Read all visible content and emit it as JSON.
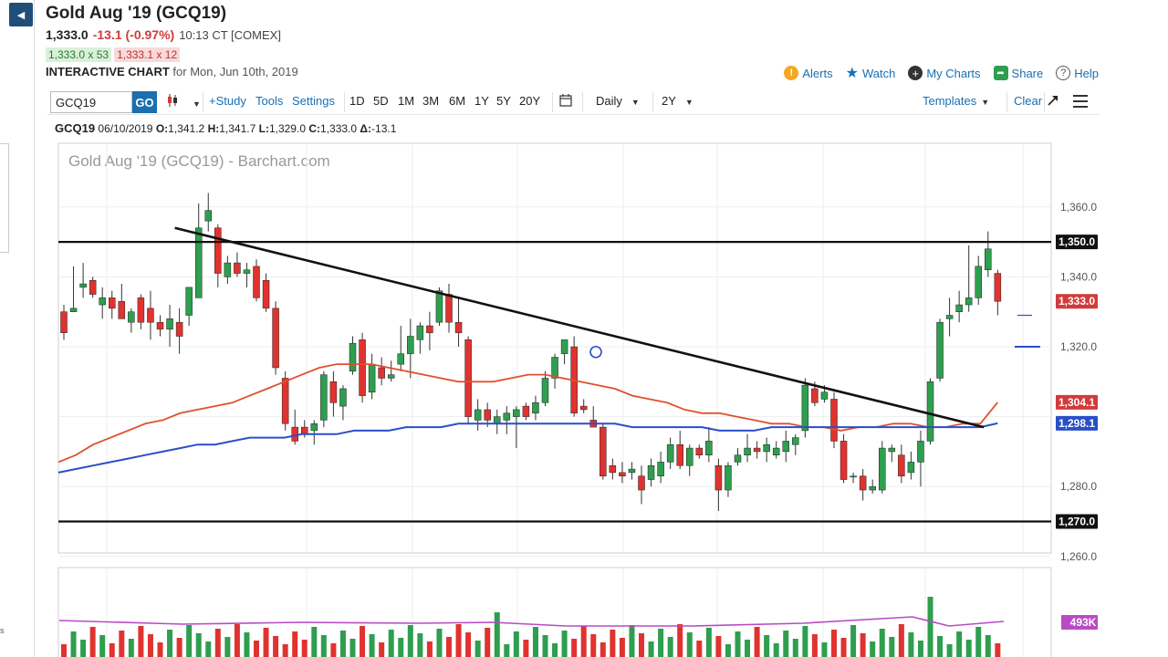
{
  "header": {
    "title": "Gold Aug '19 (GCQ19)",
    "last": "1,333.0",
    "change": "-13.1 (-0.97%)",
    "time": "10:13 CT [COMEX]",
    "bid": "1,333.0 x 53",
    "ask": "1,333.1 x 12",
    "interactive_label": "INTERACTIVE CHART",
    "interactive_date": "for Mon, Jun 10th, 2019"
  },
  "links": {
    "alerts": "Alerts",
    "watch": "Watch",
    "my_charts": "My Charts",
    "share": "Share",
    "help": "Help"
  },
  "toolbar": {
    "symbol": "GCQ19",
    "go": "GO",
    "study": "+Study",
    "tools": "Tools",
    "settings": "Settings",
    "ranges": [
      "1D",
      "5D",
      "1M",
      "3M",
      "6M",
      "1Y",
      "5Y",
      "20Y"
    ],
    "interval": "Daily",
    "period": "2Y",
    "templates": "Templates",
    "clear": "Clear"
  },
  "ohlc": {
    "symbol": "GCQ19",
    "date": "06/10/2019",
    "open_label": "O:",
    "open": "1,341.2",
    "high_label": "H:",
    "high": "1,341.7",
    "low_label": "L:",
    "low": "1,329.0",
    "close_label": "C:",
    "close": "1,333.0",
    "change": "-13.1"
  },
  "chart_data": {
    "type": "candlestick",
    "watermark": "Gold Aug '19 (GCQ19) - Barchart.com",
    "ylim": [
      1255,
      1366
    ],
    "y_ticks": [
      "1,360.0",
      "1,340.0",
      "1,320.0",
      "1,280.0",
      "1,260.0"
    ],
    "y_tick_values": [
      1360,
      1340,
      1320,
      1280,
      1260
    ],
    "price_tags": [
      {
        "label": "1,350.0",
        "value": 1350,
        "color": "#111111"
      },
      {
        "label": "1,333.0",
        "value": 1333,
        "color": "#d23b3b"
      },
      {
        "label": "1,304.1",
        "value": 1304.1,
        "color": "#d23b3b"
      },
      {
        "label": "1,298.1",
        "value": 1298.1,
        "color": "#2a4fc7"
      },
      {
        "label": "1,270.0",
        "value": 1270,
        "color": "#111111"
      }
    ],
    "horizontal_lines": [
      1350,
      1270
    ],
    "trendline": {
      "from": [
        12,
        1354
      ],
      "to": [
        95,
        1297
      ]
    },
    "candles": [
      {
        "o": 1330,
        "h": 1332,
        "l": 1322,
        "c": 1324
      },
      {
        "o": 1330,
        "h": 1343,
        "l": 1330,
        "c": 1331
      },
      {
        "o": 1337,
        "h": 1344,
        "l": 1334,
        "c": 1338
      },
      {
        "o": 1339,
        "h": 1340,
        "l": 1334,
        "c": 1335
      },
      {
        "o": 1332,
        "h": 1337,
        "l": 1328,
        "c": 1334
      },
      {
        "o": 1334,
        "h": 1336,
        "l": 1328,
        "c": 1331
      },
      {
        "o": 1333,
        "h": 1338,
        "l": 1330,
        "c": 1328
      },
      {
        "o": 1327,
        "h": 1331,
        "l": 1324,
        "c": 1330
      },
      {
        "o": 1334,
        "h": 1335,
        "l": 1325,
        "c": 1327
      },
      {
        "o": 1331,
        "h": 1336,
        "l": 1322,
        "c": 1327
      },
      {
        "o": 1327,
        "h": 1329,
        "l": 1323,
        "c": 1325
      },
      {
        "o": 1325,
        "h": 1332,
        "l": 1320,
        "c": 1328
      },
      {
        "o": 1327,
        "h": 1331,
        "l": 1318,
        "c": 1323
      },
      {
        "o": 1329,
        "h": 1337,
        "l": 1326,
        "c": 1337
      },
      {
        "o": 1334,
        "h": 1361,
        "l": 1334,
        "c": 1354
      },
      {
        "o": 1356,
        "h": 1364,
        "l": 1353,
        "c": 1359
      },
      {
        "o": 1354,
        "h": 1355,
        "l": 1337,
        "c": 1341
      },
      {
        "o": 1340,
        "h": 1346,
        "l": 1338,
        "c": 1344
      },
      {
        "o": 1344,
        "h": 1347,
        "l": 1340,
        "c": 1341
      },
      {
        "o": 1341,
        "h": 1344,
        "l": 1337,
        "c": 1342
      },
      {
        "o": 1343,
        "h": 1345,
        "l": 1333,
        "c": 1334
      },
      {
        "o": 1339,
        "h": 1341,
        "l": 1330,
        "c": 1331
      },
      {
        "o": 1331,
        "h": 1333,
        "l": 1312,
        "c": 1314
      },
      {
        "o": 1311,
        "h": 1313,
        "l": 1296,
        "c": 1298
      },
      {
        "o": 1297,
        "h": 1302,
        "l": 1292,
        "c": 1293
      },
      {
        "o": 1297,
        "h": 1299,
        "l": 1294,
        "c": 1295
      },
      {
        "o": 1296,
        "h": 1299,
        "l": 1292,
        "c": 1298
      },
      {
        "o": 1299,
        "h": 1313,
        "l": 1297,
        "c": 1312
      },
      {
        "o": 1310,
        "h": 1313,
        "l": 1300,
        "c": 1304
      },
      {
        "o": 1303,
        "h": 1309,
        "l": 1299,
        "c": 1308
      },
      {
        "o": 1313,
        "h": 1323,
        "l": 1312,
        "c": 1321
      },
      {
        "o": 1322,
        "h": 1324,
        "l": 1304,
        "c": 1306
      },
      {
        "o": 1307,
        "h": 1318,
        "l": 1305,
        "c": 1315
      },
      {
        "o": 1314,
        "h": 1317,
        "l": 1309,
        "c": 1311
      },
      {
        "o": 1311,
        "h": 1316,
        "l": 1310,
        "c": 1312
      },
      {
        "o": 1315,
        "h": 1326,
        "l": 1313,
        "c": 1318
      },
      {
        "o": 1318,
        "h": 1328,
        "l": 1311,
        "c": 1323
      },
      {
        "o": 1322,
        "h": 1327,
        "l": 1318,
        "c": 1326
      },
      {
        "o": 1326,
        "h": 1330,
        "l": 1319,
        "c": 1324
      },
      {
        "o": 1327,
        "h": 1337,
        "l": 1326,
        "c": 1336
      },
      {
        "o": 1335,
        "h": 1338,
        "l": 1324,
        "c": 1327
      },
      {
        "o": 1327,
        "h": 1334,
        "l": 1320,
        "c": 1324
      },
      {
        "o": 1322,
        "h": 1323,
        "l": 1298,
        "c": 1300
      },
      {
        "o": 1299,
        "h": 1305,
        "l": 1296,
        "c": 1302
      },
      {
        "o": 1302,
        "h": 1304,
        "l": 1297,
        "c": 1299
      },
      {
        "o": 1298,
        "h": 1302,
        "l": 1295,
        "c": 1300
      },
      {
        "o": 1299,
        "h": 1303,
        "l": 1295,
        "c": 1301
      },
      {
        "o": 1300,
        "h": 1303,
        "l": 1291,
        "c": 1302
      },
      {
        "o": 1303,
        "h": 1304,
        "l": 1299,
        "c": 1300
      },
      {
        "o": 1301,
        "h": 1306,
        "l": 1299,
        "c": 1304
      },
      {
        "o": 1304,
        "h": 1313,
        "l": 1303,
        "c": 1311
      },
      {
        "o": 1311,
        "h": 1318,
        "l": 1308,
        "c": 1317
      },
      {
        "o": 1318,
        "h": 1322,
        "l": 1315,
        "c": 1322
      },
      {
        "o": 1320,
        "h": 1323,
        "l": 1300,
        "c": 1301
      },
      {
        "o": 1303,
        "h": 1305,
        "l": 1301,
        "c": 1302
      },
      {
        "o": 1299,
        "h": 1303,
        "l": 1297,
        "c": 1297
      },
      {
        "o": 1297,
        "h": 1298,
        "l": 1282,
        "c": 1283
      },
      {
        "o": 1286,
        "h": 1288,
        "l": 1282,
        "c": 1284
      },
      {
        "o": 1284,
        "h": 1287,
        "l": 1281,
        "c": 1283
      },
      {
        "o": 1284,
        "h": 1287,
        "l": 1282,
        "c": 1285
      },
      {
        "o": 1283,
        "h": 1286,
        "l": 1275,
        "c": 1279
      },
      {
        "o": 1282,
        "h": 1288,
        "l": 1280,
        "c": 1286
      },
      {
        "o": 1283,
        "h": 1290,
        "l": 1281,
        "c": 1287
      },
      {
        "o": 1287,
        "h": 1294,
        "l": 1285,
        "c": 1292
      },
      {
        "o": 1292,
        "h": 1296,
        "l": 1285,
        "c": 1286
      },
      {
        "o": 1286,
        "h": 1292,
        "l": 1283,
        "c": 1291
      },
      {
        "o": 1291,
        "h": 1292,
        "l": 1288,
        "c": 1289
      },
      {
        "o": 1289,
        "h": 1297,
        "l": 1287,
        "c": 1293
      },
      {
        "o": 1286,
        "h": 1288,
        "l": 1273,
        "c": 1279
      },
      {
        "o": 1279,
        "h": 1287,
        "l": 1277,
        "c": 1286
      },
      {
        "o": 1287,
        "h": 1291,
        "l": 1286,
        "c": 1289
      },
      {
        "o": 1289,
        "h": 1295,
        "l": 1287,
        "c": 1291
      },
      {
        "o": 1291,
        "h": 1293,
        "l": 1288,
        "c": 1290
      },
      {
        "o": 1290,
        "h": 1294,
        "l": 1287,
        "c": 1292
      },
      {
        "o": 1289,
        "h": 1293,
        "l": 1288,
        "c": 1291
      },
      {
        "o": 1290,
        "h": 1296,
        "l": 1287,
        "c": 1293
      },
      {
        "o": 1292,
        "h": 1295,
        "l": 1289,
        "c": 1294
      },
      {
        "o": 1296,
        "h": 1311,
        "l": 1294,
        "c": 1309
      },
      {
        "o": 1308,
        "h": 1310,
        "l": 1303,
        "c": 1304
      },
      {
        "o": 1305,
        "h": 1309,
        "l": 1304,
        "c": 1307
      },
      {
        "o": 1305,
        "h": 1307,
        "l": 1291,
        "c": 1293
      },
      {
        "o": 1293,
        "h": 1295,
        "l": 1281,
        "c": 1282
      },
      {
        "o": 1283,
        "h": 1284,
        "l": 1281,
        "c": 1283
      },
      {
        "o": 1283,
        "h": 1285,
        "l": 1276,
        "c": 1279
      },
      {
        "o": 1279,
        "h": 1282,
        "l": 1278,
        "c": 1280
      },
      {
        "o": 1279,
        "h": 1293,
        "l": 1278,
        "c": 1291
      },
      {
        "o": 1290,
        "h": 1292,
        "l": 1287,
        "c": 1291
      },
      {
        "o": 1289,
        "h": 1292,
        "l": 1281,
        "c": 1283
      },
      {
        "o": 1284,
        "h": 1290,
        "l": 1282,
        "c": 1287
      },
      {
        "o": 1287,
        "h": 1296,
        "l": 1280,
        "c": 1293
      },
      {
        "o": 1293,
        "h": 1311,
        "l": 1292,
        "c": 1310
      },
      {
        "o": 1311,
        "h": 1328,
        "l": 1310,
        "c": 1327
      },
      {
        "o": 1328,
        "h": 1334,
        "l": 1323,
        "c": 1329
      },
      {
        "o": 1330,
        "h": 1336,
        "l": 1327,
        "c": 1332
      },
      {
        "o": 1332,
        "h": 1349,
        "l": 1330,
        "c": 1334
      },
      {
        "o": 1334,
        "h": 1346,
        "l": 1332,
        "c": 1343
      },
      {
        "o": 1342,
        "h": 1353,
        "l": 1340,
        "c": 1348
      },
      {
        "o": 1341,
        "h": 1342,
        "l": 1329,
        "c": 1333
      }
    ],
    "ma_red": [
      1287,
      1289,
      1292,
      1294,
      1296,
      1298,
      1299,
      1301,
      1302,
      1303,
      1304,
      1306,
      1308,
      1310,
      1312,
      1314,
      1315,
      1315,
      1315,
      1314,
      1313,
      1312,
      1311,
      1310,
      1310,
      1310,
      1311,
      1312,
      1312,
      1311,
      1310,
      1309,
      1308,
      1306,
      1305,
      1304,
      1302,
      1301,
      1301,
      1300,
      1299,
      1298,
      1298,
      1297,
      1297,
      1296,
      1297,
      1297,
      1298,
      1298,
      1297,
      1297,
      1298,
      1298,
      1304.1
    ],
    "ma_blue": [
      1284,
      1285,
      1286,
      1287,
      1288,
      1289,
      1290,
      1291,
      1292,
      1292,
      1293,
      1294,
      1294,
      1294,
      1295,
      1295,
      1295,
      1296,
      1296,
      1296,
      1297,
      1297,
      1297,
      1298,
      1298,
      1298,
      1298,
      1298,
      1298,
      1298,
      1298,
      1298,
      1298,
      1297,
      1297,
      1297,
      1297,
      1297,
      1296,
      1296,
      1296,
      1297,
      1297,
      1297,
      1297,
      1297,
      1297,
      1297,
      1297,
      1297,
      1297,
      1297,
      1297,
      1297,
      1298.1
    ],
    "volume_label": "493K",
    "volume_tag_color": "#b84bc4"
  }
}
